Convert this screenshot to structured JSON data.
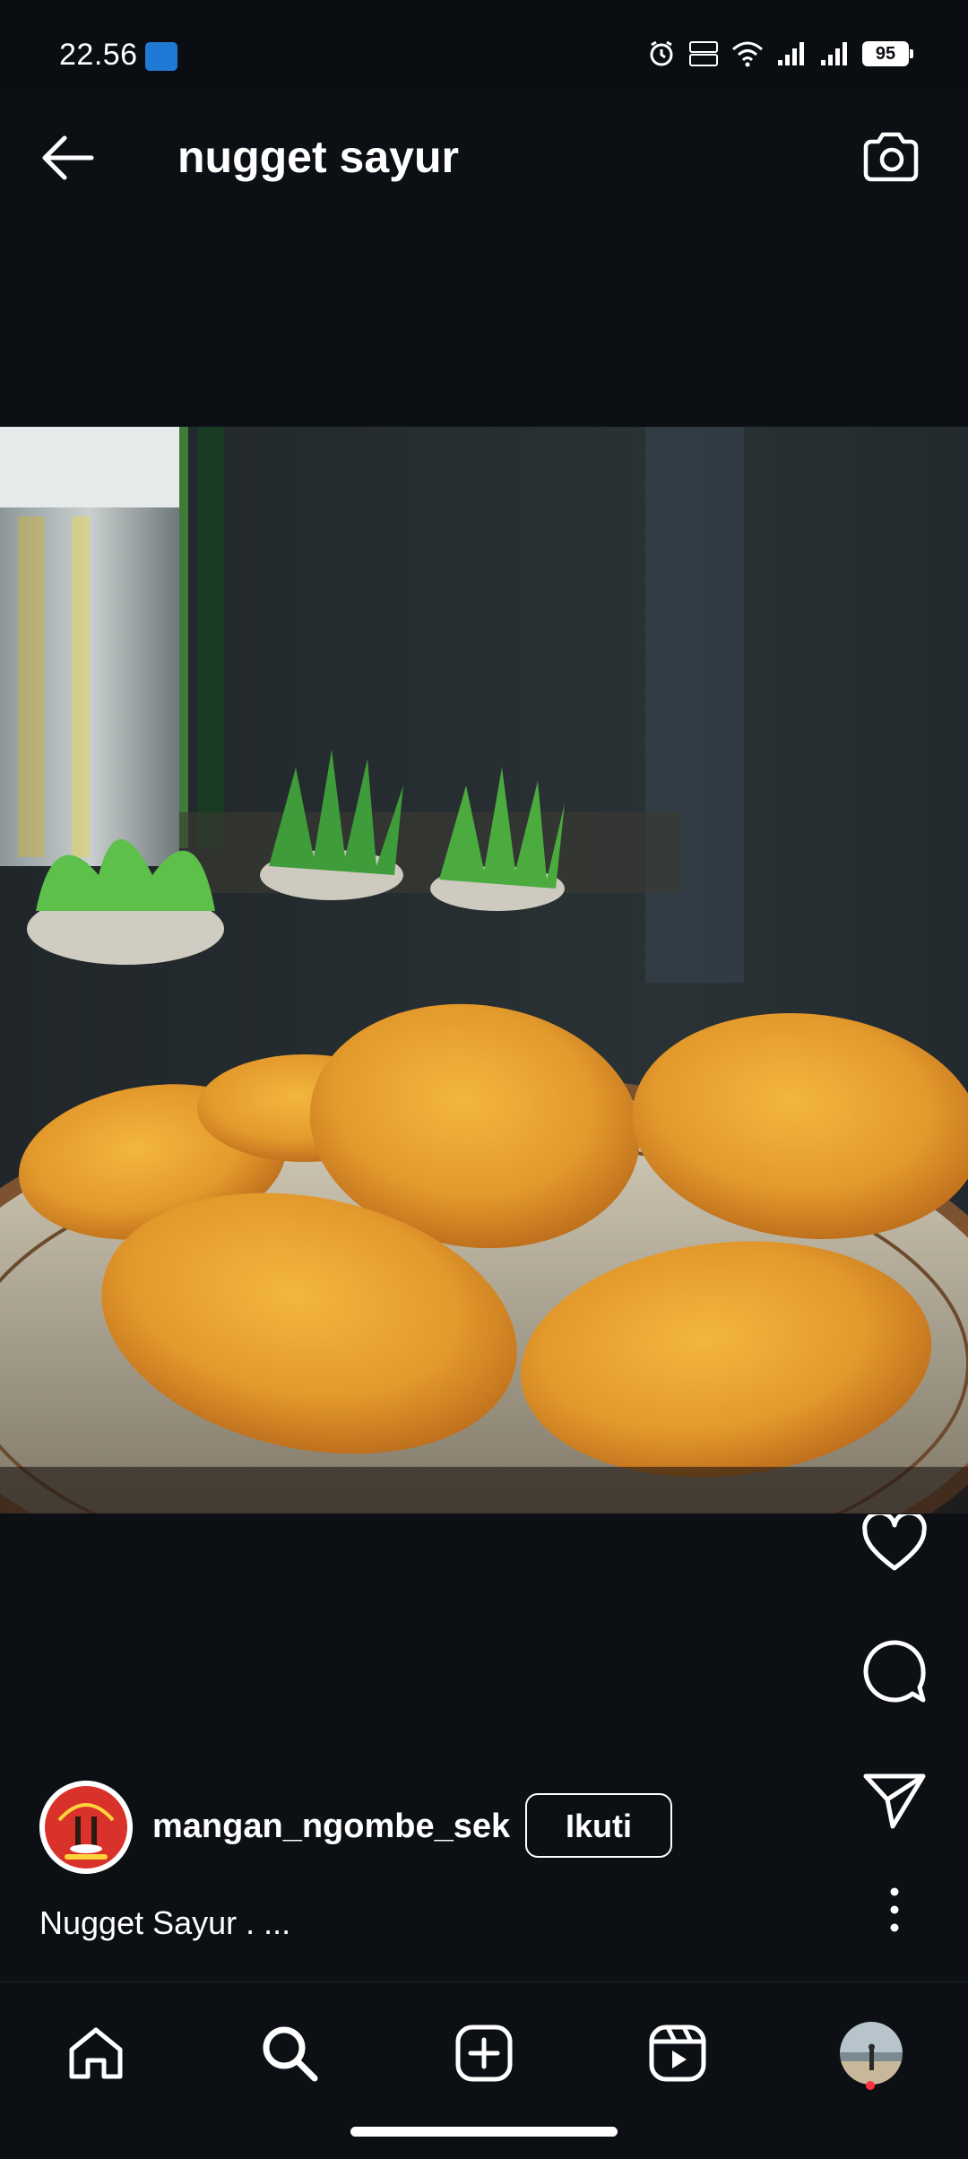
{
  "status_bar": {
    "time": "22.56",
    "battery": "95",
    "icons": [
      "app-notification-icon",
      "alarm-icon",
      "volte-icon",
      "wifi-icon",
      "signal-icon",
      "signal-icon",
      "battery-icon"
    ]
  },
  "header": {
    "title": "nugget sayur",
    "back_icon": "arrow-left-icon",
    "camera_icon": "camera-icon"
  },
  "post": {
    "image_alt": "Nugget Sayur",
    "actions": [
      "heart-icon",
      "comment-icon",
      "share-icon",
      "more-vertical-icon"
    ],
    "author": {
      "username": "mangan_ngombe_sek",
      "follow_label": "Ikuti"
    },
    "caption": "Nugget Sayur . ..."
  },
  "bottom_nav": {
    "items": [
      "home-icon",
      "search-icon",
      "create-icon",
      "reels-icon",
      "profile-avatar"
    ],
    "active": "search-icon"
  },
  "colors": {
    "background": "#0c1014",
    "text": "#ffffff",
    "notification_dot": "#ff3040"
  }
}
